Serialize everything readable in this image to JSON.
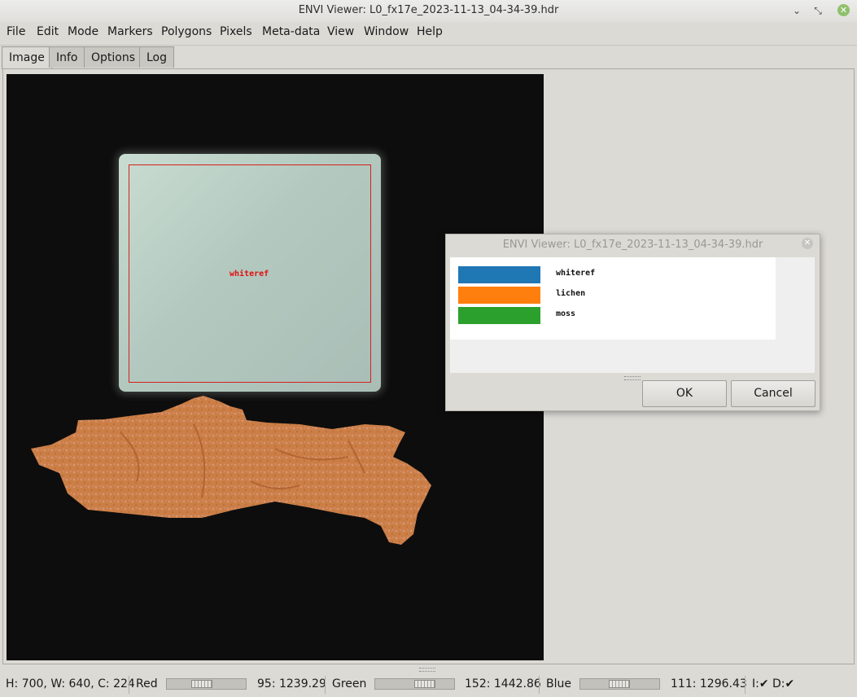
{
  "window": {
    "title": "ENVI Viewer: L0_fx17e_2023-11-13_04-34-39.hdr"
  },
  "menu": [
    "File",
    "Edit",
    "Mode",
    "Markers",
    "Polygons",
    "Pixels",
    "Meta-data",
    "View",
    "Window",
    "Help"
  ],
  "tabs": [
    {
      "label": "Image",
      "active": true
    },
    {
      "label": "Info",
      "active": false
    },
    {
      "label": "Options",
      "active": false
    },
    {
      "label": "Log",
      "active": false
    }
  ],
  "image": {
    "roi_label": "whiteref",
    "roi_color": "#d42020",
    "lichen_overlay_color": "#e08a4a"
  },
  "dialog": {
    "title": "ENVI Viewer: L0_fx17e_2023-11-13_04-34-39.hdr",
    "classes": [
      {
        "label": "whiteref",
        "color": "#1f77b4"
      },
      {
        "label": "lichen",
        "color": "#ff7f0e"
      },
      {
        "label": "moss",
        "color": "#2ca02c"
      }
    ],
    "ok_label": "OK",
    "cancel_label": "Cancel"
  },
  "status": {
    "dims": "H: 700, W: 640, C: 224",
    "red_label": "Red",
    "red_value": "95: 1239.29",
    "red_slider_fraction": 0.42,
    "green_label": "Green",
    "green_value": "152: 1442.86",
    "green_slider_fraction": 0.68,
    "blue_label": "Blue",
    "blue_value": "111: 1296.43",
    "blue_slider_fraction": 0.49,
    "flags": "I:✔ D:✔"
  },
  "icons": [
    "minimize-icon",
    "restore-icon",
    "close-icon"
  ]
}
